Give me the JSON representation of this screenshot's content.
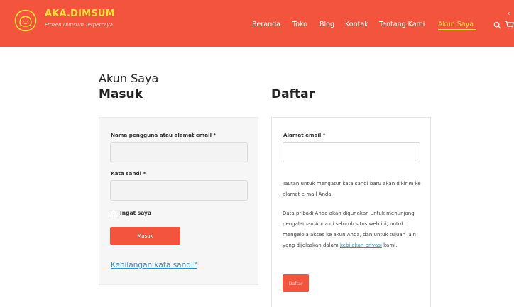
{
  "header": {
    "brand": "AKA.DIMSUM",
    "tagline": "Frozen Dimsum Terpercaya",
    "nav": [
      "Beranda",
      "Toko",
      "Blog",
      "Kontak",
      "Tentang Kami",
      "Akun Saya"
    ],
    "active_nav": "Akun Saya",
    "cart_count": "0",
    "icons": [
      "logo-icon",
      "search-icon",
      "cart-icon"
    ],
    "colors": {
      "header_bg": "#f2543d",
      "brand": "#ffe03a",
      "active_nav": "#ffe03a"
    }
  },
  "page": {
    "title": "Akun Saya"
  },
  "login": {
    "heading": "Masuk",
    "username_label": "Nama pengguna atau alamat email *",
    "username_value": "",
    "password_label": "Kata sandi *",
    "password_value": "",
    "remember_label": "Ingat saya",
    "remember_checked": false,
    "submit_label": "Masuk",
    "lost_password": "Kehilangan kata sandi?"
  },
  "register": {
    "heading": "Daftar",
    "email_label": "Alamat email *",
    "email_value": "",
    "link_notice": "Tautan untuk mengatur kata sandi baru akan dikirim ke alamat e-mail Anda.",
    "privacy_text": "Data pribadi Anda akan digunakan untuk menunjang pengalaman Anda di seluruh situs web ini, untuk mengelola akses ke akun Anda, dan untuk tujuan lain yang dijelaskan dalam",
    "privacy_link": "kebijakan privasi",
    "privacy_suffix": " kami.",
    "submit_label": "Daftar"
  },
  "colors": {
    "accent": "#f2543d",
    "link": "#3a8fc2"
  }
}
